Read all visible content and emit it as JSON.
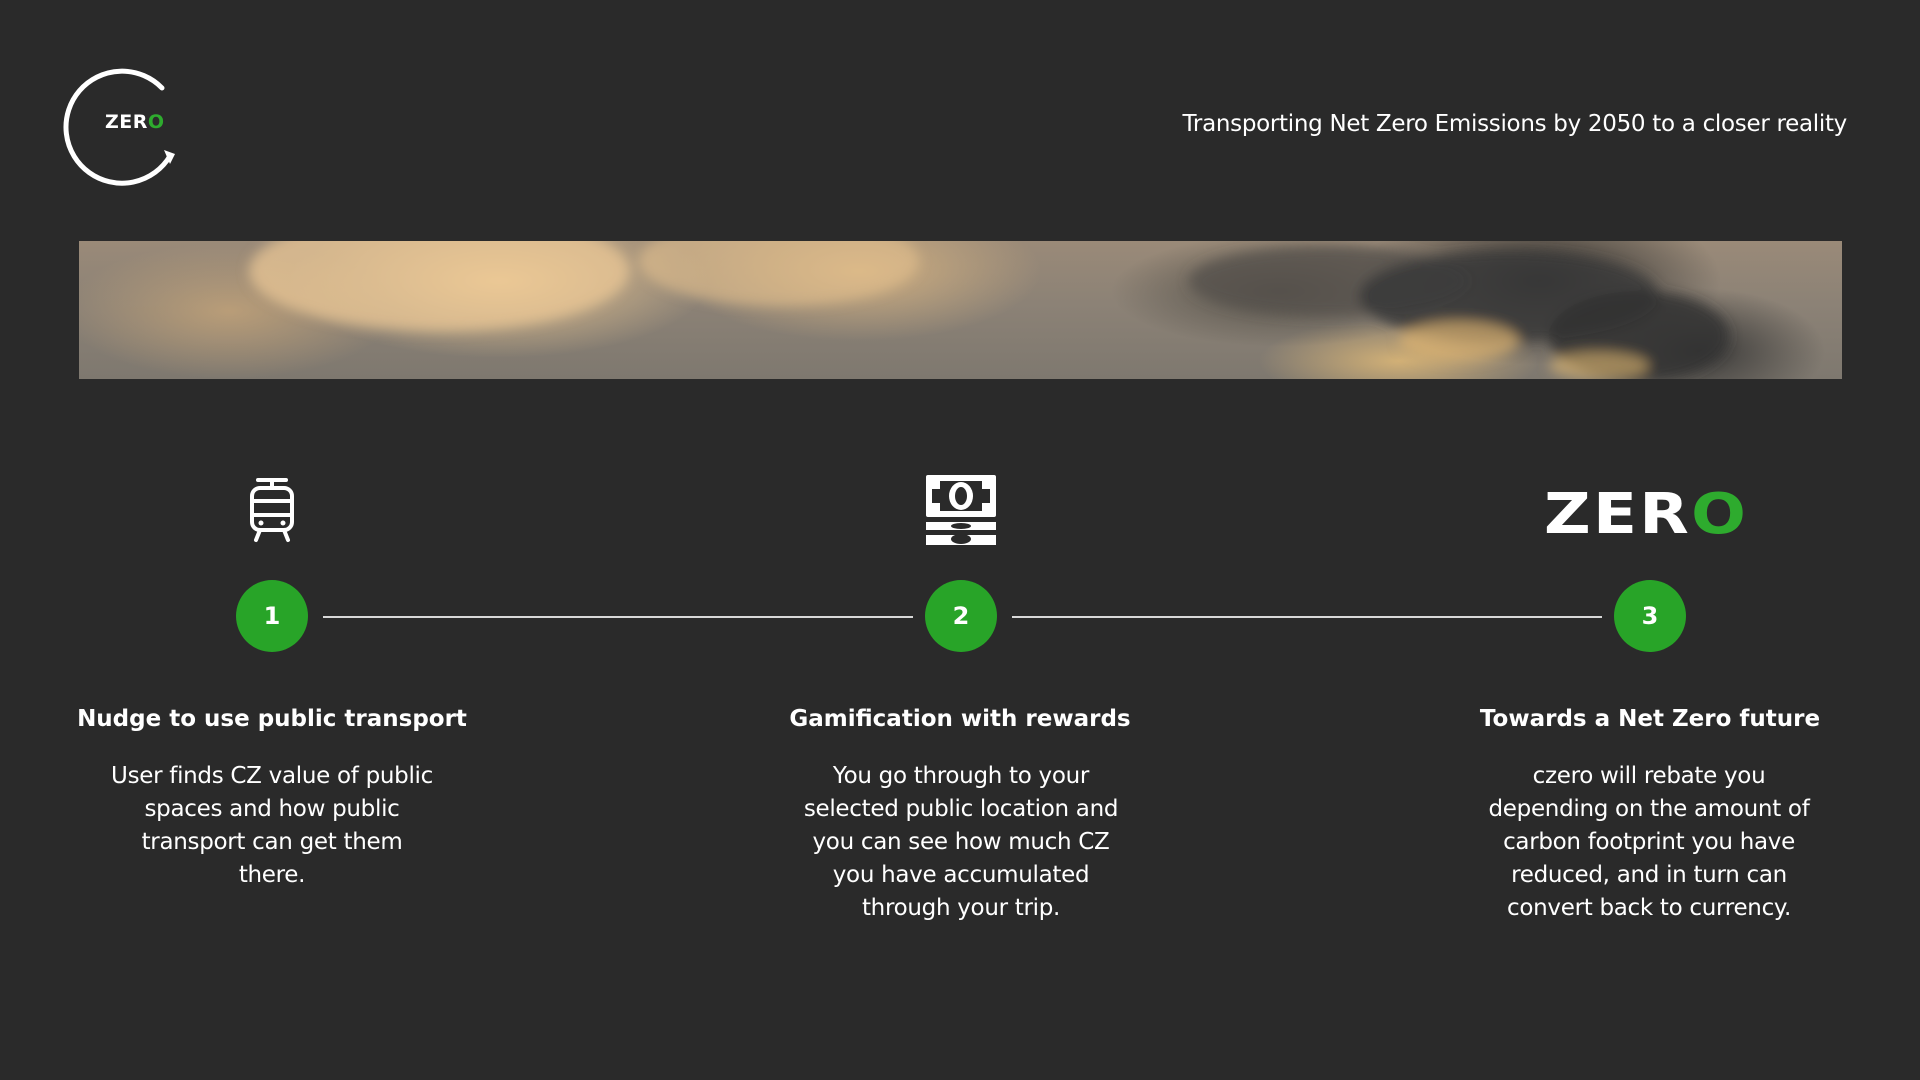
{
  "header": {
    "logo": {
      "icon": "circular-arrow-logo-icon",
      "text_main": "ZER",
      "text_accent": "O",
      "accent_color": "#2eab2e"
    },
    "tagline": "Transporting Net Zero Emissions by 2050 to a closer reality"
  },
  "banner": {
    "icon": "smoke-clouds-image"
  },
  "steps": [
    {
      "number": "1",
      "icon": "tram-icon",
      "title": "Nudge to use public transport",
      "description": "User finds CZ value of public spaces and how public transport can get them there."
    },
    {
      "number": "2",
      "icon": "money-icon",
      "title": "Gamification with rewards",
      "description": "You go through to your selected public location and you can see how much CZ you have accumulated through your trip."
    },
    {
      "number": "3",
      "icon": "zero-logo-icon",
      "icon_text_main": "ZER",
      "icon_text_accent": "O",
      "title": "Towards a Net Zero future",
      "description": "czero will rebate you depending on the amount of carbon footprint you have reduced, and in turn can convert back to currency."
    }
  ],
  "colors": {
    "background": "#2a2a2a",
    "accent": "#28a428",
    "text": "#ffffff"
  }
}
